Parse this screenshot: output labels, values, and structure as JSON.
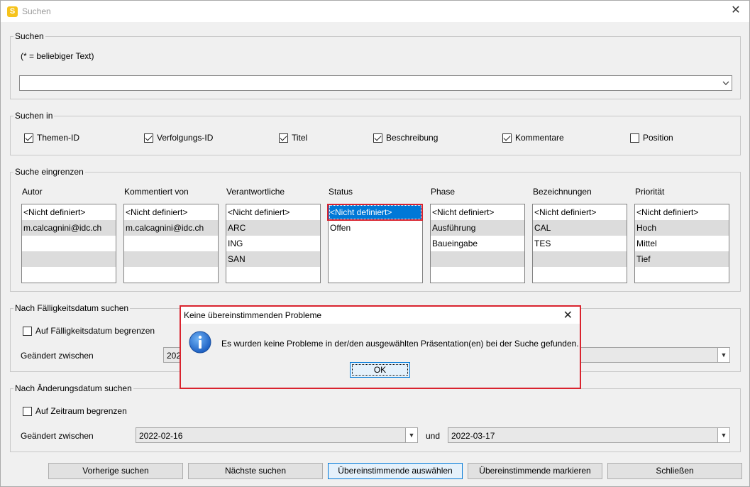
{
  "window": {
    "title": "Suchen",
    "app_icon": "S"
  },
  "search": {
    "group_label": "Suchen",
    "hint": "(* = beliebiger Text)",
    "value": "",
    "arrow_icon": "chevron-down-icon"
  },
  "search_in": {
    "group_label": "Suchen in",
    "options": [
      {
        "label": "Themen-ID",
        "checked": true
      },
      {
        "label": "Verfolgungs-ID",
        "checked": true
      },
      {
        "label": "Titel",
        "checked": true
      },
      {
        "label": "Beschreibung",
        "checked": true
      },
      {
        "label": "Kommentare",
        "checked": true
      },
      {
        "label": "Position",
        "checked": false
      }
    ]
  },
  "filter": {
    "group_label": "Suche eingrenzen",
    "columns": [
      {
        "label": "Autor",
        "items": [
          "<Nicht definiert>",
          "m.calcagnini@idc.ch"
        ]
      },
      {
        "label": "Kommentiert von",
        "items": [
          "<Nicht definiert>",
          "m.calcagnini@idc.ch"
        ]
      },
      {
        "label": "Verantwortliche",
        "items": [
          "<Nicht definiert>",
          "ARC",
          "ING",
          "SAN"
        ]
      },
      {
        "label": "Status",
        "items": [
          "<Nicht definiert>",
          "Offen"
        ],
        "selected": 0
      },
      {
        "label": "Phase",
        "items": [
          "<Nicht definiert>",
          "Ausführung",
          "Baueingabe"
        ]
      },
      {
        "label": "Bezeichnungen",
        "items": [
          "<Nicht definiert>",
          "CAL",
          "TES"
        ]
      },
      {
        "label": "Priorität",
        "items": [
          "<Nicht definiert>",
          "Hoch",
          "Mittel",
          "Tief"
        ]
      }
    ]
  },
  "due_date": {
    "group_label": "Nach Fälligkeitsdatum suchen",
    "checkbox_label": "Auf Fälligkeitsdatum begrenzen",
    "checked": false,
    "changed_between_label": "Geändert zwischen",
    "from_value_partial": "202",
    "to_value": ""
  },
  "change_date": {
    "group_label": "Nach Änderungsdatum suchen",
    "checkbox_label": "Auf Zeitraum begrenzen",
    "checked": false,
    "changed_between_label": "Geändert zwischen",
    "from_value": "2022-02-16",
    "and_label": "und",
    "to_value": "2022-03-17"
  },
  "buttons": {
    "previous": "Vorherige suchen",
    "next": "Nächste suchen",
    "select_matching": "Übereinstimmende auswählen",
    "mark_matching": "Übereinstimmende markieren",
    "close": "Schließen"
  },
  "dialog": {
    "title": "Keine übereinstimmenden Probleme",
    "message": "Es wurden keine Probleme in der/den ausgewählten Präsentation(en) bei der Suche gefunden.",
    "ok": "OK",
    "icon": "info-icon"
  },
  "colors": {
    "selection": "#0078d7",
    "highlight_border": "#d9232e",
    "alt_row": "#dcdcdc"
  }
}
